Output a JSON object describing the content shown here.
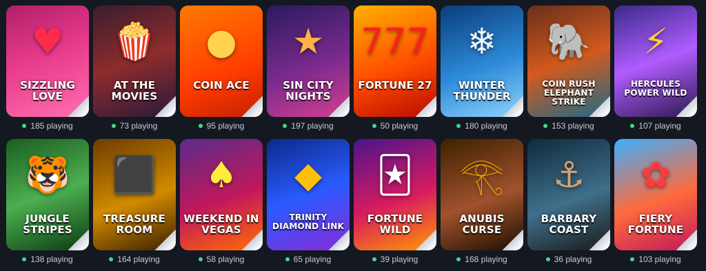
{
  "games": [
    {
      "title": "Sizzling Love",
      "players": "185 playing",
      "bg": "linear-gradient(160deg,#b0206a,#e73a8b 45%,#ff6fb0)",
      "accent": "#ff2b4a",
      "icon": "heart-icon",
      "glyph": "♥"
    },
    {
      "title": "At the Movies",
      "players": "73 playing",
      "bg": "linear-gradient(160deg,#3b1d2e,#8d2c2c 50%,#2a1a3a)",
      "accent": "#e8d38a",
      "icon": "popcorn-icon",
      "glyph": "🍿"
    },
    {
      "title": "Coin Ace",
      "players": "95 playing",
      "bg": "linear-gradient(160deg,#ff7a00,#ff3d00 60%,#c62000)",
      "accent": "#ffd34d",
      "icon": "coin-icon",
      "glyph": "●"
    },
    {
      "title": "Sin City Nights",
      "players": "197 playing",
      "bg": "linear-gradient(160deg,#2a1b5e,#7b2a8e 55%,#d33f8f)",
      "accent": "#ffb347",
      "icon": "showgirl-icon",
      "glyph": "★"
    },
    {
      "title": "Fortune 27",
      "players": "50 playing",
      "bg": "linear-gradient(160deg,#ffb000,#ff4d00 55%,#b80b00)",
      "accent": "#ff1f1f",
      "icon": "sevens-icon",
      "glyph": "777"
    },
    {
      "title": "Winter Thunder",
      "players": "180 playing",
      "bg": "linear-gradient(160deg,#0a3d7a,#2d8ad8 55%,#8fd3ff)",
      "accent": "#e9f4ff",
      "icon": "wolf-icon",
      "glyph": "❄"
    },
    {
      "title": "Coin Rush Elephant Strike",
      "players": "153 playing",
      "bg": "linear-gradient(160deg,#6a2f1a,#d25a1e 50%,#1e6a88)",
      "accent": "#ff7a2a",
      "icon": "elephant-icon",
      "glyph": "🐘"
    },
    {
      "title": "Hercules Power Wild",
      "players": "107 playing",
      "bg": "linear-gradient(160deg,#3a2a8a,#b05cff 50%,#2c1a4d)",
      "accent": "#ffc940",
      "icon": "hercules-icon",
      "glyph": "⚡"
    },
    {
      "title": "Jungle Stripes",
      "players": "138 playing",
      "bg": "linear-gradient(160deg,#1b5e20,#4caf50 50%,#0d3b12)",
      "accent": "#f9a825",
      "icon": "tiger-icon",
      "glyph": "🐯"
    },
    {
      "title": "Treasure Room",
      "players": "164 playing",
      "bg": "linear-gradient(160deg,#6d3d00,#d28b00 55%,#3a1f00)",
      "accent": "#ffd54f",
      "icon": "treasure-chest-icon",
      "glyph": "⬛"
    },
    {
      "title": "Weekend in Vegas",
      "players": "58 playing",
      "bg": "linear-gradient(160deg,#5a2b8a,#c2185b 55%,#ff6f00)",
      "accent": "#ffeb3b",
      "icon": "vegas-man-icon",
      "glyph": "♠"
    },
    {
      "title": "Trinity Diamond Link",
      "players": "65 playing",
      "bg": "linear-gradient(160deg,#0b2a8a,#2a5bff 50%,#8a2ad8)",
      "accent": "#ffc107",
      "icon": "diamond-icon",
      "glyph": "◆"
    },
    {
      "title": "Fortune Wild",
      "players": "39 playing",
      "bg": "linear-gradient(160deg,#4a148c,#d81b60 55%,#ff9800)",
      "accent": "#fff",
      "icon": "jester-icon",
      "glyph": "🃏"
    },
    {
      "title": "Anubis Curse",
      "players": "168 playing",
      "bg": "linear-gradient(160deg,#3e2100,#a0522d 55%,#1c0f00)",
      "accent": "#ffb300",
      "icon": "anubis-icon",
      "glyph": "𓂀"
    },
    {
      "title": "Barbary Coast",
      "players": "36 playing",
      "bg": "linear-gradient(160deg,#0f2b3d,#3f6f8a 55%,#1a1a1a)",
      "accent": "#d4a373",
      "icon": "pirate-icon",
      "glyph": "⚓"
    },
    {
      "title": "Fiery Fortune",
      "players": "103 playing",
      "bg": "linear-gradient(160deg,#3bb0ff,#ff6a3d 55%,#c2185b)",
      "accent": "#ff3b3b",
      "icon": "flower-icon",
      "glyph": "✿"
    }
  ]
}
